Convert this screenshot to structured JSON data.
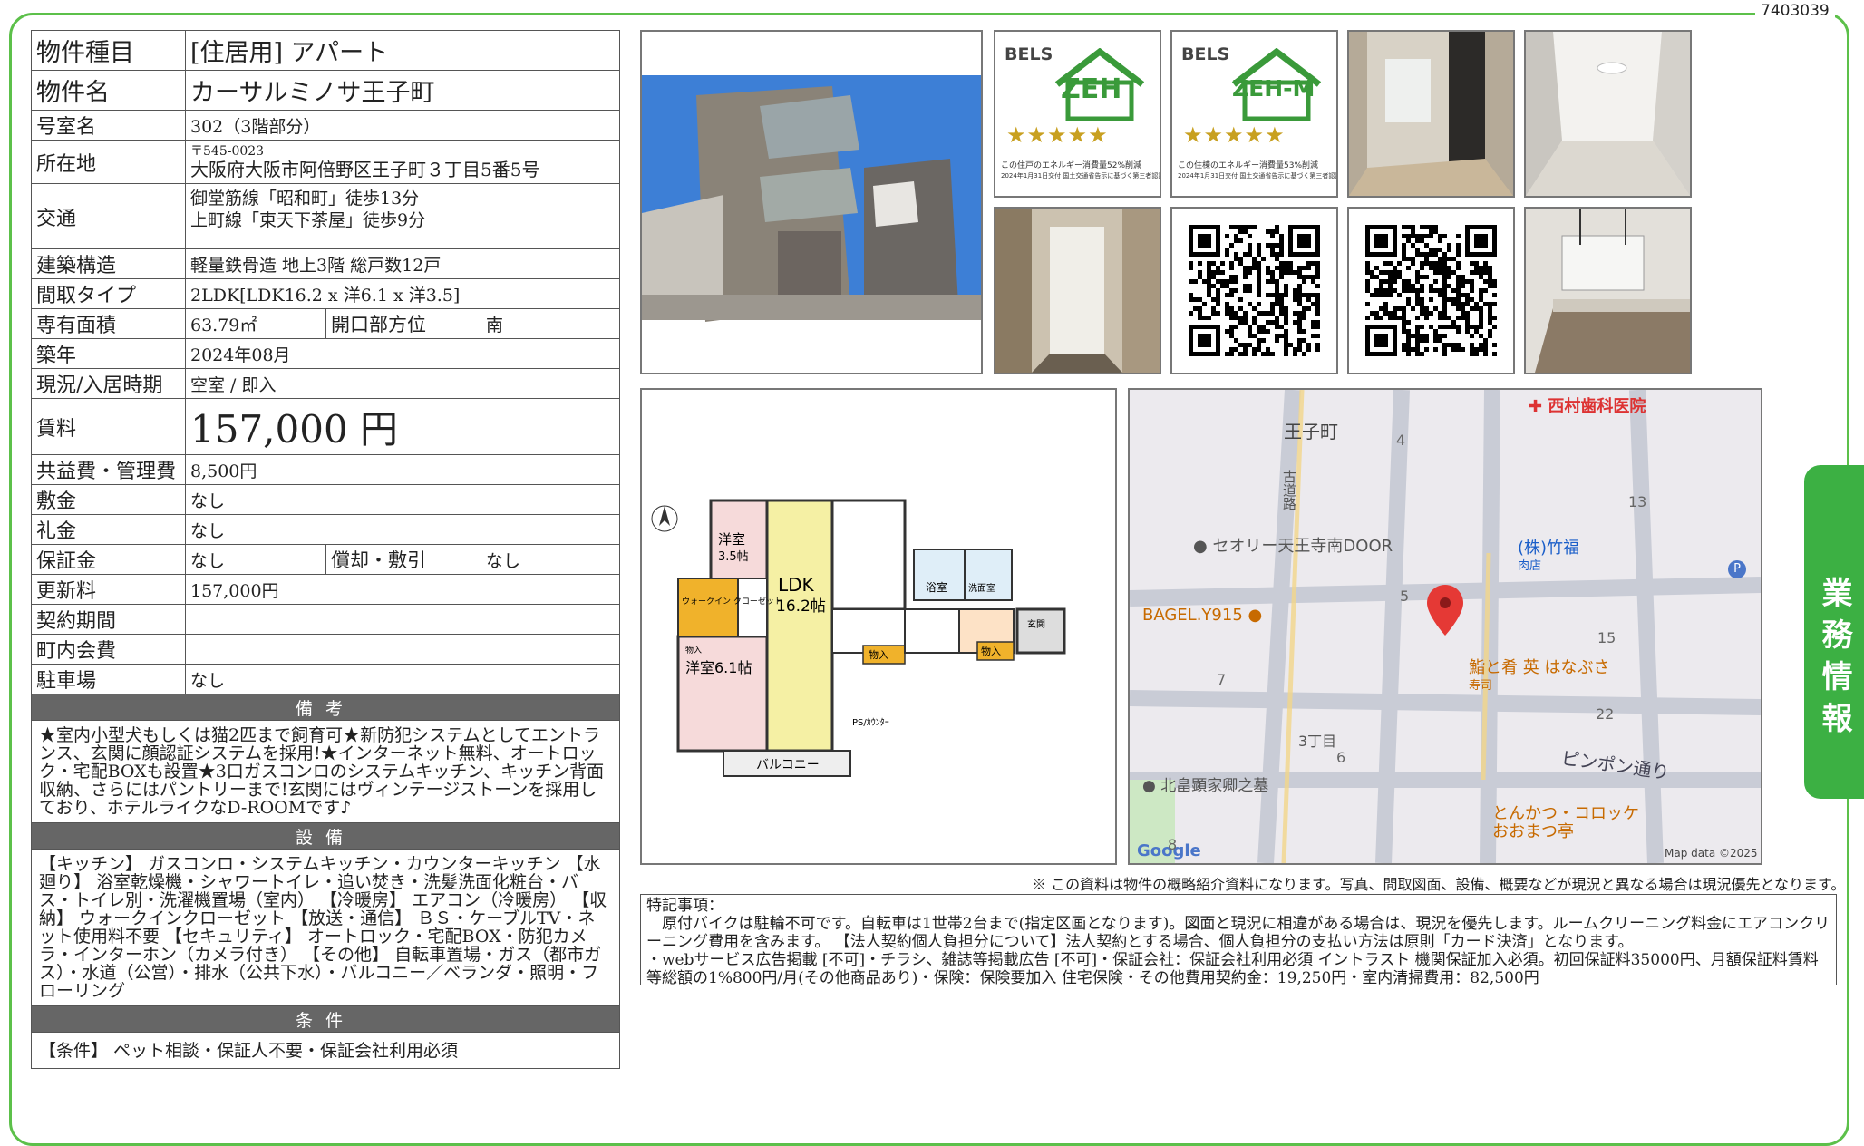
{
  "doc_id": "7403039",
  "side_tab": "業務情報",
  "property": {
    "type_label": "物件種目",
    "type_value": "[住居用] アパート",
    "name_label": "物件名",
    "name_value": "カーサルミノサ王子町",
    "room_label": "号室名",
    "room_value": "302（3階部分）",
    "address_label": "所在地",
    "postal": "〒545-0023",
    "address": "大阪府大阪市阿倍野区王子町３丁目5番5号",
    "transit_label": "交通",
    "transit_1": "御堂筋線「昭和町」徒歩13分",
    "transit_2": "上町線「東天下茶屋」徒歩9分",
    "structure_label": "建築構造",
    "structure_value": "軽量鉄骨造 地上3階 総戸数12戸",
    "layout_label": "間取タイプ",
    "layout_value": "2LDK[LDK16.2 x 洋6.1 x 洋3.5]",
    "area_label": "専有面積",
    "area_value": "63.79㎡",
    "direction_label": "開口部方位",
    "direction_value": "南",
    "built_label": "築年",
    "built_value": "2024年08月",
    "status_label": "現況/入居時期",
    "status_value": "空室 / 即入",
    "rent_label": "賃料",
    "rent_value": "157,000 円",
    "fee_label": "共益費・管理費",
    "fee_value": "8,500円",
    "deposit_label": "敷金",
    "deposit_value": "なし",
    "key_money_label": "礼金",
    "key_money_value": "なし",
    "guarantee_label": "保証金",
    "guarantee_value": "なし",
    "amort_label": "償却・敷引",
    "amort_value": "なし",
    "renewal_label": "更新料",
    "renewal_value": "157,000円",
    "contract_label": "契約期間",
    "contract_value": "",
    "town_label": "町内会費",
    "town_value": "",
    "parking_label": "駐車場",
    "parking_value": "なし"
  },
  "remarks_head": "備考",
  "remarks": "★室内小型犬もしくは猫2匹まで飼育可★新防犯システムとしてエントランス、玄関に顔認証システムを採用!★インターネット無料、オートロック・宅配BOXも設置★3口ガスコンロのシステムキッチン、キッチン背面収納、さらにはパントリーまで!玄関にはヴィンテージストーンを採用しており、ホテルライクなD-ROOMです♪",
  "equipment_head": "設備",
  "equipment": "【キッチン】 ガスコンロ・システムキッチン・カウンターキッチン 【水廻り】 浴室乾燥機・シャワートイレ・追い焚き・洗髪洗面化粧台・バス・トイレ別・洗濯機置場（室内） 【冷暖房】 エアコン（冷暖房） 【収納】 ウォークインクローゼット 【放送・通信】 ＢＳ・ケーブルTV・ネット使用料不要 【セキュリティ】 オートロック・宅配BOX・防犯カメラ・インターホン（カメラ付き） 【その他】 自転車置場・ガス（都市ガス）・水道（公営）・排水（公共下水）・バルコニー／ベランダ・照明・フローリング",
  "conditions_head": "条件",
  "conditions": "【条件】 ペット相談・保証人不要・保証会社利用必須",
  "bels": [
    {
      "title": "BELS",
      "mark": "ZEH",
      "stars": "★★★★★",
      "line1": "この住戸のエネルギー消費量52%削減",
      "line2": "2024年1月31日交付 国土交通省告示に基づく第三者認証"
    },
    {
      "title": "BELS",
      "mark": "ZEH-M",
      "stars": "★★★★★",
      "line1": "この住棟のエネルギー消費量53%削減",
      "line2": "2024年1月31日交付 国土交通省告示に基づく第三者認証"
    }
  ],
  "floorplan": {
    "room1": "洋室",
    "room1_size": "3.5帖",
    "ldk": "LDK",
    "ldk_size": "16.2帖",
    "room2": "洋室6.1帖",
    "closet": "ウォークイン クローゼット",
    "bath": "浴室",
    "wash": "洗面室",
    "entrance": "玄関",
    "storage1": "物入",
    "storage2": "物入",
    "balcony": "バルコニー",
    "ps": "PS/ｶｳﾝﾀｰ",
    "shelf": "物入"
  },
  "map": {
    "area": "王子町",
    "clinic": "西村歯科医院",
    "door": "セオリー天王寺南DOOR",
    "takefuku": "(株)竹福",
    "takefuku_sub": "肉店",
    "bagel": "BAGEL.Y915",
    "sushi": "鮨と肴 英 はなぶさ",
    "sushi_sub": "寿司",
    "pingpong": "ピンポン通り",
    "kitajima": "北畠顕家卿之墓",
    "tonkatsu": "とんかつ・コロッケ",
    "tonkatsu_sub": "おおまつ亭",
    "block": "3丁目",
    "road": "古道路",
    "google": "Google",
    "mapdata": "Map data ©2025",
    "n4": "4",
    "n13": "13",
    "n5": "5",
    "n15": "15",
    "n7": "7",
    "n22": "22",
    "n6": "6",
    "n8": "8",
    "p": "P"
  },
  "disclaimer": "※ この資料は物件の概略紹介資料になります。写真、間取図面、設備、概要などが現況と異なる場合は現況優先となります。",
  "notes_head": "特記事項：",
  "notes_1": "原付バイクは駐輪不可です。自転車は1世帯2台まで(指定区画となります)。図面と現況に相違がある場合は、現況を優先します。ルームクリーニング料金にエアコンクリーニング費用を含みます。 【法人契約個人負担分について】法人契約とする場合、個人負担分の支払い方法は原則「カード決済」となります。",
  "notes_2": "・webサービス広告掲載 [不可]・チラシ、雑誌等掲載広告 [不可]・保証会社：保証会社利用必須 イントラスト 機関保証加入必須。初回保証料35000円、月額保証料賃料等総額の1%800円/月(その他商品あり)・保険：保険要加入 住宅保険・その他費用契約金：19,250円・室内清掃費用：82,500円"
}
